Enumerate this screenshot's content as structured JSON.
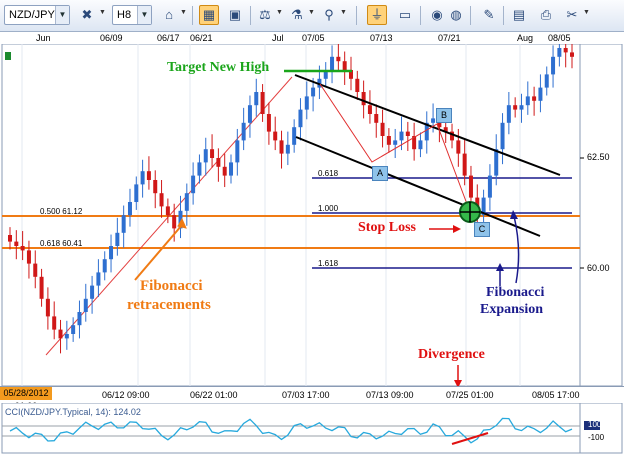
{
  "toolbar": {
    "symbol": "NZD/JPY",
    "timeframe": "H8"
  },
  "chart": {
    "top_dates": [
      "Jun",
      "06/09",
      "06/17",
      "06/21",
      "Jul",
      "07/05",
      "07/13",
      "07/21",
      "Aug",
      "08/05"
    ],
    "price_labels": [
      "62.50",
      "60.00"
    ],
    "time_labels": [
      "06/12 09:00",
      "06/22 01:00",
      "07/03 17:00",
      "07/13 09:00",
      "07/25 01:00",
      "08/05 17:00"
    ],
    "current_date": "05/28/2012 01:00",
    "levels": {
      "retr_0500": "0.500 61.12",
      "retr_0618": "0.618 60.41",
      "exp_0618": "0.618",
      "exp_1000": "1.000",
      "exp_1618": "1.618"
    },
    "points": {
      "a": "A",
      "b": "B",
      "c": "C"
    },
    "annotations": {
      "target": "Target New High",
      "stop_loss": "Stop Loss",
      "fib_retr_line1": "Fibonacci",
      "fib_retr_line2": "retracements",
      "fib_exp_line1": "Fibonacci",
      "fib_exp_line2": "Expansion",
      "divergence": "Divergence"
    },
    "colors": {
      "bull": "#2e6fd0",
      "bear": "#d01818",
      "retracement": "#f07b14",
      "expansion": "#1a1a8c",
      "channel": "#000000",
      "target": "#1aa51a",
      "stop": "#e01010"
    }
  },
  "cci": {
    "label": "CCI(NZD/JPY.Typical, 14): 124.02",
    "ticks": [
      "100",
      "-100"
    ]
  },
  "chart_data": {
    "type": "candlestick",
    "x_ticks": [
      "06/12 09:00",
      "06/22 01:00",
      "07/03 17:00",
      "07/13 09:00",
      "07/25 01:00",
      "08/05 17:00"
    ],
    "y_ticks": [
      62.5,
      60.0
    ],
    "close": [
      60.6,
      60.5,
      60.4,
      60.1,
      59.8,
      59.3,
      58.9,
      58.6,
      58.4,
      58.5,
      58.7,
      59.0,
      59.3,
      59.6,
      59.9,
      60.2,
      60.5,
      60.8,
      61.2,
      61.5,
      61.9,
      62.2,
      62.0,
      61.7,
      61.4,
      61.2,
      60.9,
      61.3,
      61.7,
      62.1,
      62.4,
      62.7,
      62.5,
      62.3,
      62.1,
      62.4,
      62.9,
      63.3,
      63.7,
      64.0,
      63.5,
      63.1,
      62.9,
      62.6,
      62.8,
      63.2,
      63.6,
      63.9,
      64.1,
      64.3,
      64.5,
      64.8,
      64.7,
      64.5,
      64.3,
      64.0,
      63.7,
      63.5,
      63.3,
      63.0,
      62.8,
      62.9,
      63.1,
      63.0,
      62.7,
      62.9,
      63.3,
      63.4,
      63.2,
      63.1,
      62.9,
      62.6,
      62.1,
      61.6,
      61.2,
      61.6,
      62.1,
      62.7,
      63.3,
      63.7,
      63.6,
      63.7,
      63.9,
      63.8,
      64.1,
      64.4,
      64.8,
      65.0,
      64.9,
      64.8
    ]
  }
}
